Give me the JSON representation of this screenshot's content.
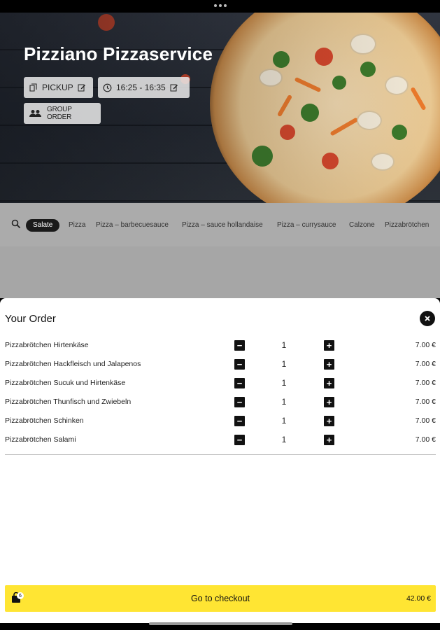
{
  "restaurant": {
    "name": "Pizziano Pizzaservice"
  },
  "hero_chips": {
    "pickup_label": "PICKUP",
    "time_label": "16:25 - 16:35",
    "group_order_label": "GROUP ORDER"
  },
  "categories": [
    "Salate",
    "Pizza",
    "Pizza – barbecuesauce",
    "Pizza – sauce hollandaise",
    "Pizza – currysauce",
    "Calzone",
    "Pizzabrötchen"
  ],
  "active_category": "Salate",
  "order": {
    "title": "Your Order",
    "items": [
      {
        "name": "Pizzabrötchen Hirtenkäse",
        "qty": "1",
        "price": "7.00 €"
      },
      {
        "name": "Pizzabrötchen Hackfleisch und Jalapenos",
        "qty": "1",
        "price": "7.00 €"
      },
      {
        "name": "Pizzabrötchen Sucuk und Hirtenkäse",
        "qty": "1",
        "price": "7.00 €"
      },
      {
        "name": "Pizzabrötchen Thunfisch und Zwiebeln",
        "qty": "1",
        "price": "7.00 €"
      },
      {
        "name": "Pizzabrötchen Schinken",
        "qty": "1",
        "price": "7.00 €"
      },
      {
        "name": "Pizzabrötchen Salami",
        "qty": "1",
        "price": "7.00 €"
      }
    ],
    "minus_symbol": "−",
    "plus_symbol": "+"
  },
  "checkout": {
    "label": "Go to checkout",
    "total": "42.00 €",
    "cart_count": "6"
  },
  "colors": {
    "accent_yellow": "#ffe533",
    "dark": "#111111",
    "menu_gray": "#a6a6a6"
  },
  "icons": [
    "pickup-icon",
    "edit-icon",
    "clock-icon",
    "group-icon",
    "search-icon",
    "close-icon",
    "shopping-bag-icon"
  ]
}
